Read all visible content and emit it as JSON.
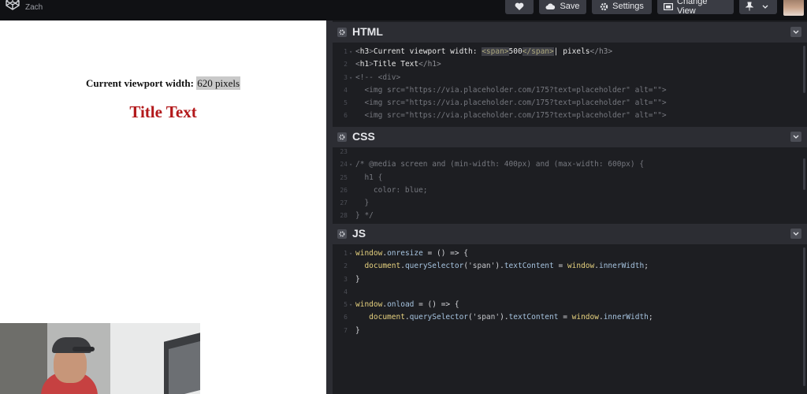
{
  "topbar": {
    "author": "Zach",
    "buttons": {
      "save": "Save",
      "settings": "Settings",
      "change_view": "Change View"
    }
  },
  "preview": {
    "viewport_label": "Current viewport width:",
    "viewport_value": "620 pixels",
    "title": "Title Text"
  },
  "panes": {
    "html": {
      "title": "HTML",
      "line_numbers": [
        "1",
        "2",
        "3",
        "4",
        "5",
        "6"
      ],
      "lines": [
        "<h3>Current viewport width: <span>500</span> pixels</h3>",
        "<h1>Title Text</h1>",
        "<!-- <div>",
        "  <img src=\"https://via.placeholder.com/175?text=placeholder\" alt=\"\">",
        "  <img src=\"https://via.placeholder.com/175?text=placeholder\" alt=\"\">",
        "  <img src=\"https://via.placeholder.com/175?text=placeholder\" alt=\"\">"
      ]
    },
    "css": {
      "title": "CSS",
      "line_numbers": [
        "23",
        "24",
        "25",
        "26",
        "27",
        "28"
      ],
      "lines": [
        "",
        "/* @media screen and (min-width: 400px) and (max-width: 600px) {",
        "  h1 {",
        "    color: blue;",
        "  }",
        "} */"
      ]
    },
    "js": {
      "title": "JS",
      "line_numbers": [
        "1",
        "2",
        "3",
        "4",
        "5",
        "6",
        "7"
      ],
      "lines": [
        "window.onresize = () => {",
        "  document.querySelector('span').textContent = window.innerWidth;",
        "}",
        "",
        "window.onload = () => {",
        "   document.querySelector('span').textContent = window.innerWidth;",
        "}"
      ]
    }
  }
}
